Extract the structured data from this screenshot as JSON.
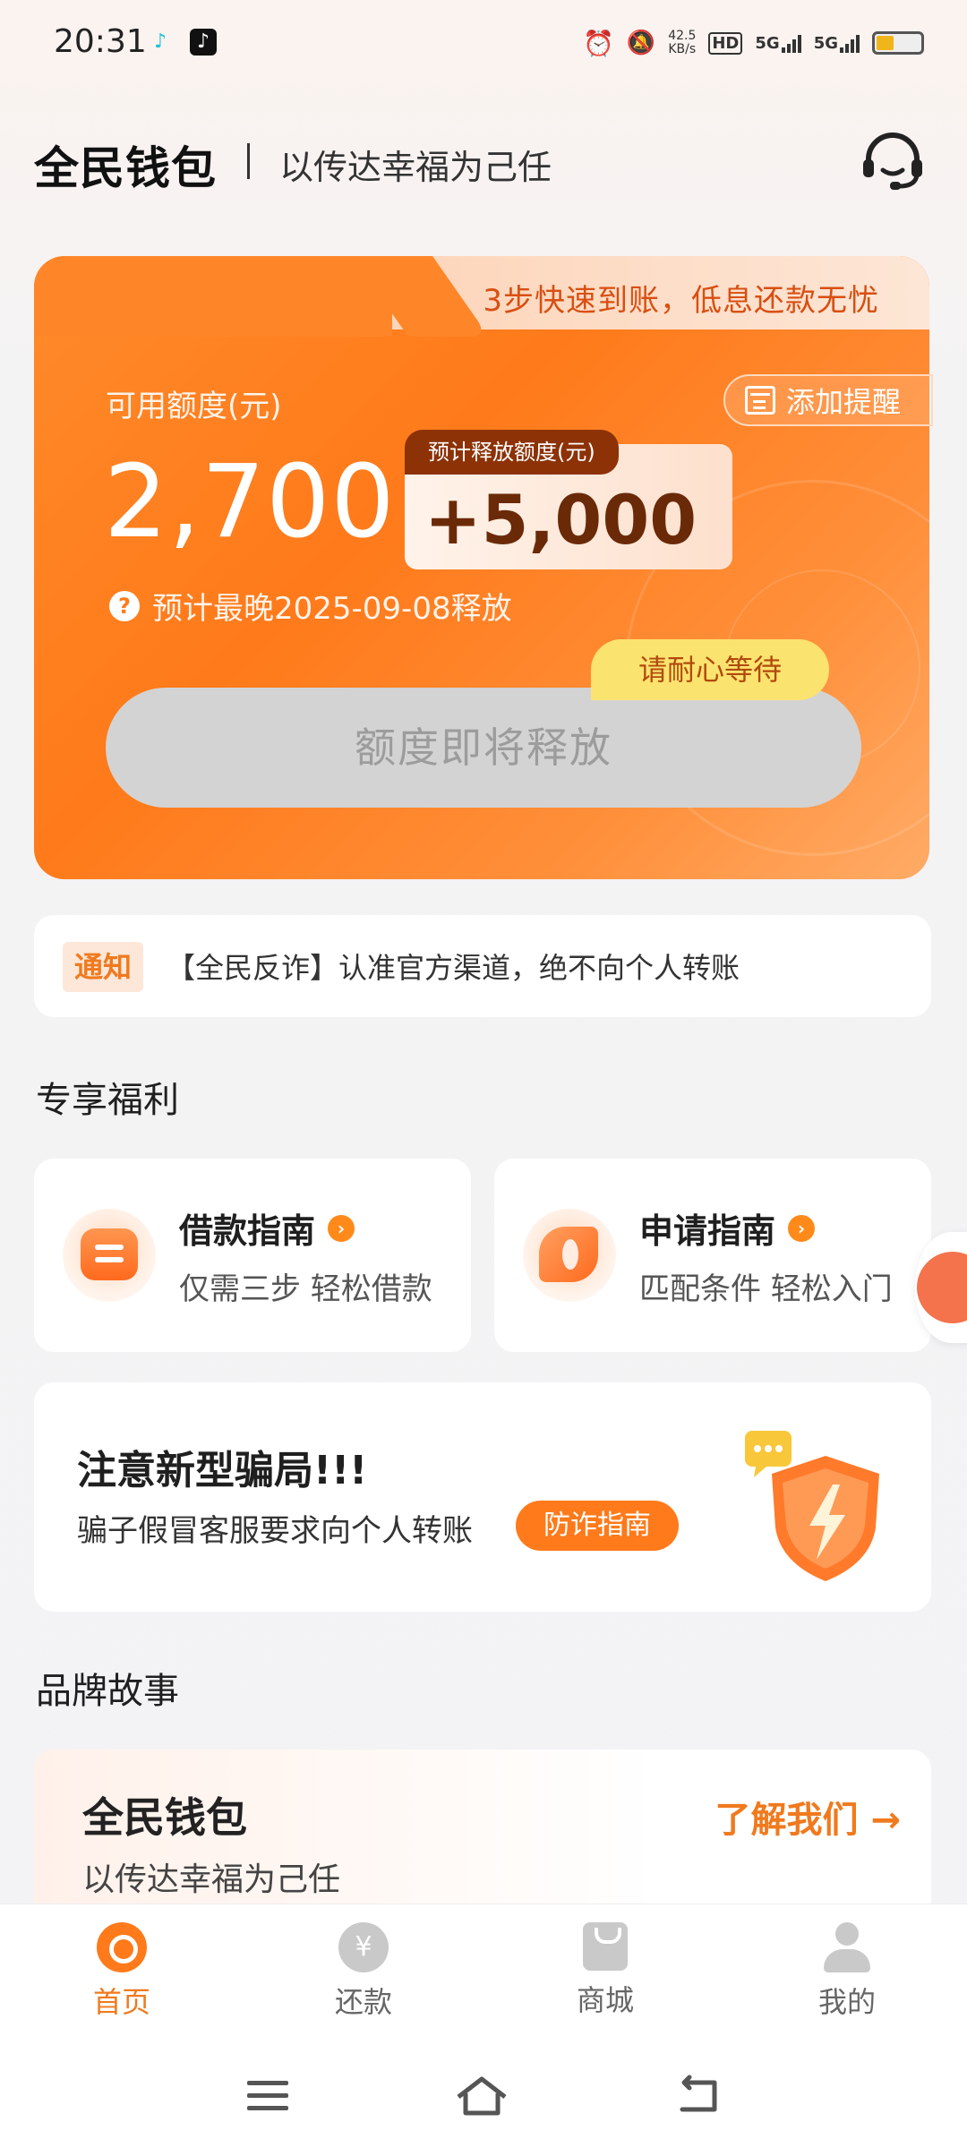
{
  "status_bar": {
    "time": "20:31",
    "net_speed_value": "42.5",
    "net_speed_unit": "KB/s",
    "hd_label": "HD",
    "sim1_label": "5G",
    "sim2_label": "5G",
    "battery_level": 0.42
  },
  "header": {
    "brand": "全民钱包",
    "slogan": "以传达幸福为己任",
    "support_icon": "headset-icon"
  },
  "credit_card": {
    "tab_text": "3步快速到账，低息还款无忧",
    "available_label": "可用额度(元)",
    "available_amount": "2,700",
    "release_tag": "预计释放额度(元)",
    "release_amount": "+5,000",
    "reminder_label": "添加提醒",
    "deadline_text": "预计最晚2025-09-08释放",
    "wait_label": "请耐心等待",
    "main_button_label": "额度即将释放"
  },
  "notice": {
    "tag": "通知",
    "text": "【全民反诈】认准官方渠道，绝不向个人转账"
  },
  "benefits": {
    "title": "专享福利",
    "items": [
      {
        "title": "借款指南",
        "subtitle": "仅需三步 轻松借款"
      },
      {
        "title": "申请指南",
        "subtitle": "匹配条件 轻松入门"
      }
    ]
  },
  "scam_alert": {
    "title": "注意新型骗局!!!",
    "text": "骗子假冒客服要求向个人转账",
    "button_label": "防诈指南"
  },
  "brand_story": {
    "section_title": "品牌故事",
    "title": "全民钱包",
    "subtitle": "以传达幸福为己任",
    "link_label": "了解我们 →"
  },
  "bottom_nav": [
    {
      "label": "首页",
      "icon": "home-icon",
      "active": true
    },
    {
      "label": "还款",
      "icon": "yen-icon",
      "active": false
    },
    {
      "label": "商城",
      "icon": "bag-icon",
      "active": false
    },
    {
      "label": "我的",
      "icon": "person-icon",
      "active": false
    }
  ],
  "colors": {
    "accent": "#ff7a1a",
    "accent_dark": "#f07a1e",
    "disabled_button": "#d3d3d3",
    "wait_pill": "#fbe36f"
  }
}
